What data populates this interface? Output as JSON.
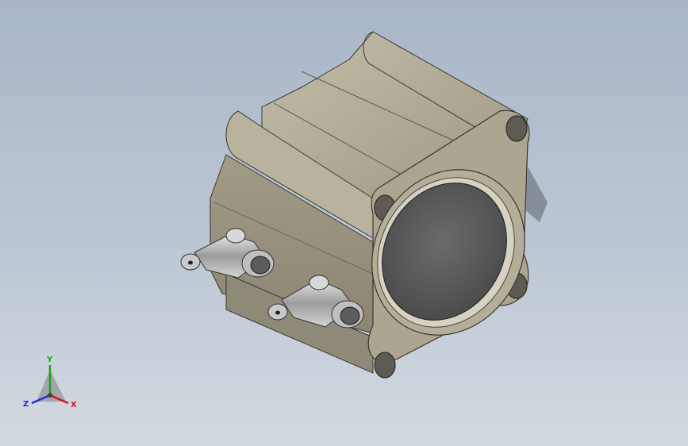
{
  "viewport": {
    "background_top": "#a9b6c8",
    "background_bottom": "#d3d9e0"
  },
  "model": {
    "body_color": "#a7a18c",
    "body_shadow": "#7d7867",
    "body_highlight": "#c9c4b0",
    "bore_color": "#5a5a5a",
    "fitting_color": "#b8b8b8"
  },
  "triad": {
    "x_label": "X",
    "y_label": "Y",
    "z_label": "Z",
    "x_color": "#d8141b",
    "y_color": "#1aa31a",
    "z_color": "#1c2fd6"
  }
}
